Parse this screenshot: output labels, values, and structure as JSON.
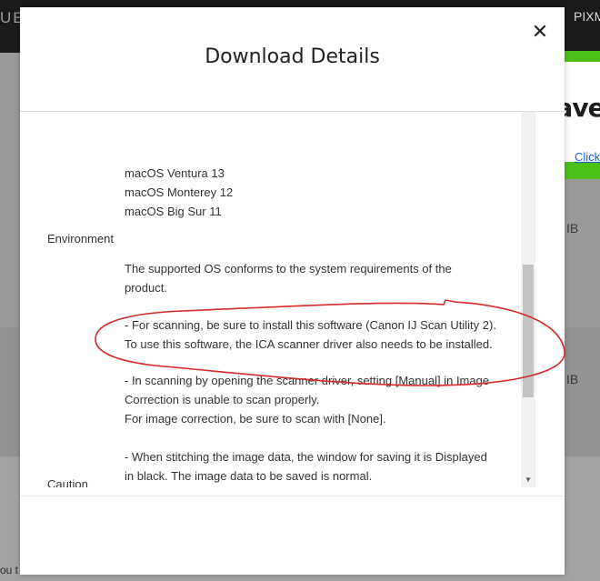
{
  "background": {
    "top_left_text": "UE",
    "top_right_text": "PIXM",
    "side_text_1": "IB",
    "side_text_2": "IB",
    "bottom_left_text": "ou t"
  },
  "ad": {
    "title": "Have a",
    "link": "Click"
  },
  "modal": {
    "title": "Download Details",
    "close_glyph": "✕",
    "environment_label": "Environment",
    "caution_label": "Caution",
    "lines": [
      "macOS Ventura 13",
      "macOS Monterey 12",
      "macOS Big Sur 11",
      "The supported OS conforms to the system requirements of the",
      "product.",
      "- For scanning, be sure to install this software (Canon IJ Scan Utility 2).",
      "To use this software, the ICA scanner driver also needs to be installed.",
      "- In scanning by opening the scanner driver, setting [Manual] in Image",
      "Correction is unable to scan properly.",
      "For image correction, be sure to scan with [None].",
      "- When stitching the image data, the window for saving it is Displayed",
      "in black. The image data to be saved is normal."
    ],
    "scroll_down_glyph": "▼"
  },
  "colors": {
    "annotation_stroke": "#d42a2a",
    "ad_green": "#4cc016"
  },
  "icons": [
    "close-icon",
    "scroll-down-arrow-icon"
  ]
}
